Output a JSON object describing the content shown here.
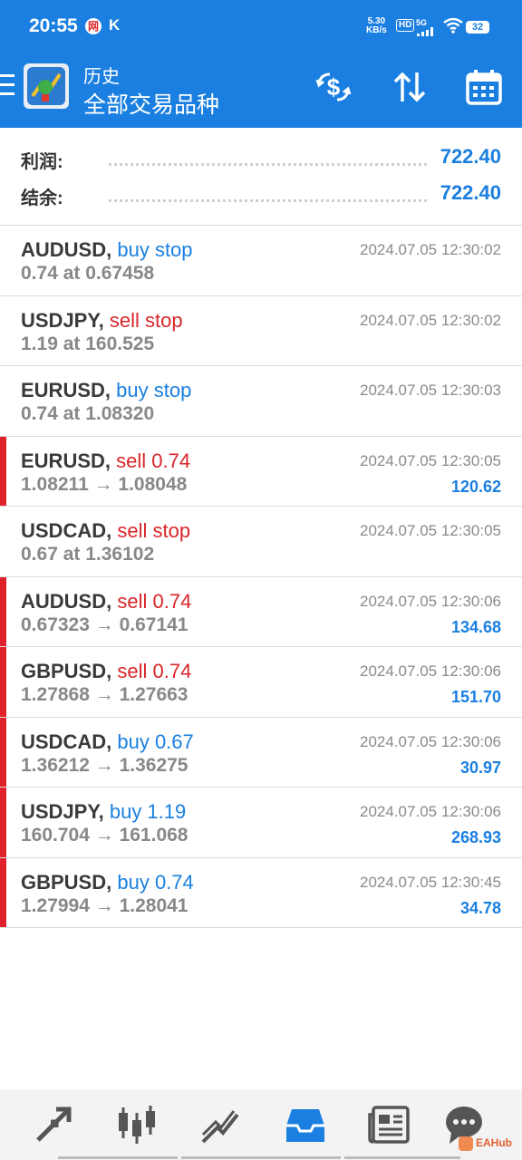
{
  "status_bar": {
    "time": "20:55",
    "notif_a": "网",
    "notif_b": "K",
    "speed_value": "5.30",
    "speed_unit": "KB/s",
    "hd": "HD",
    "network": "5G",
    "battery": "32"
  },
  "header": {
    "subtitle": "历史",
    "title": "全部交易品种",
    "color": "#1a7fe0"
  },
  "summary": {
    "profit_label": "利润:",
    "profit_value": "722.40",
    "balance_label": "结余:",
    "balance_value": "722.40"
  },
  "trades": [
    {
      "symbol": "AUDUSD,",
      "type": "buy stop",
      "side": "buy",
      "detail": "0.74 at 0.67458",
      "time": "2024.07.05 12:30:02",
      "profit": "",
      "closed": false
    },
    {
      "symbol": "USDJPY,",
      "type": "sell stop",
      "side": "sell",
      "detail": "1.19 at 160.525",
      "time": "2024.07.05 12:30:02",
      "profit": "",
      "closed": false
    },
    {
      "symbol": "EURUSD,",
      "type": "buy stop",
      "side": "buy",
      "detail": "0.74 at 1.08320",
      "time": "2024.07.05 12:30:03",
      "profit": "",
      "closed": false
    },
    {
      "symbol": "EURUSD,",
      "type": "sell 0.74",
      "side": "sell",
      "detail": "1.08211 → 1.08048",
      "time": "2024.07.05 12:30:05",
      "profit": "120.62",
      "closed": true
    },
    {
      "symbol": "USDCAD,",
      "type": "sell stop",
      "side": "sell",
      "detail": "0.67 at 1.36102",
      "time": "2024.07.05 12:30:05",
      "profit": "",
      "closed": false
    },
    {
      "symbol": "AUDUSD,",
      "type": "sell 0.74",
      "side": "sell",
      "detail": "0.67323 → 0.67141",
      "time": "2024.07.05 12:30:06",
      "profit": "134.68",
      "closed": true
    },
    {
      "symbol": "GBPUSD,",
      "type": "sell 0.74",
      "side": "sell",
      "detail": "1.27868 → 1.27663",
      "time": "2024.07.05 12:30:06",
      "profit": "151.70",
      "closed": true
    },
    {
      "symbol": "USDCAD,",
      "type": "buy 0.67",
      "side": "buy",
      "detail": "1.36212 → 1.36275",
      "time": "2024.07.05 12:30:06",
      "profit": "30.97",
      "closed": true
    },
    {
      "symbol": "USDJPY,",
      "type": "buy 1.19",
      "side": "buy",
      "detail": "160.704 → 161.068",
      "time": "2024.07.05 12:30:06",
      "profit": "268.93",
      "closed": true
    },
    {
      "symbol": "GBPUSD,",
      "type": "buy 0.74",
      "side": "buy",
      "detail": "1.27994 → 1.28041",
      "time": "2024.07.05 12:30:45",
      "profit": "34.78",
      "closed": true
    }
  ],
  "bottom_nav": {
    "items": [
      "quotes-icon",
      "chart-icon",
      "trade-icon",
      "history-icon",
      "news-icon",
      "chat-icon"
    ],
    "active": "history-icon"
  },
  "watermark": "EAHub"
}
